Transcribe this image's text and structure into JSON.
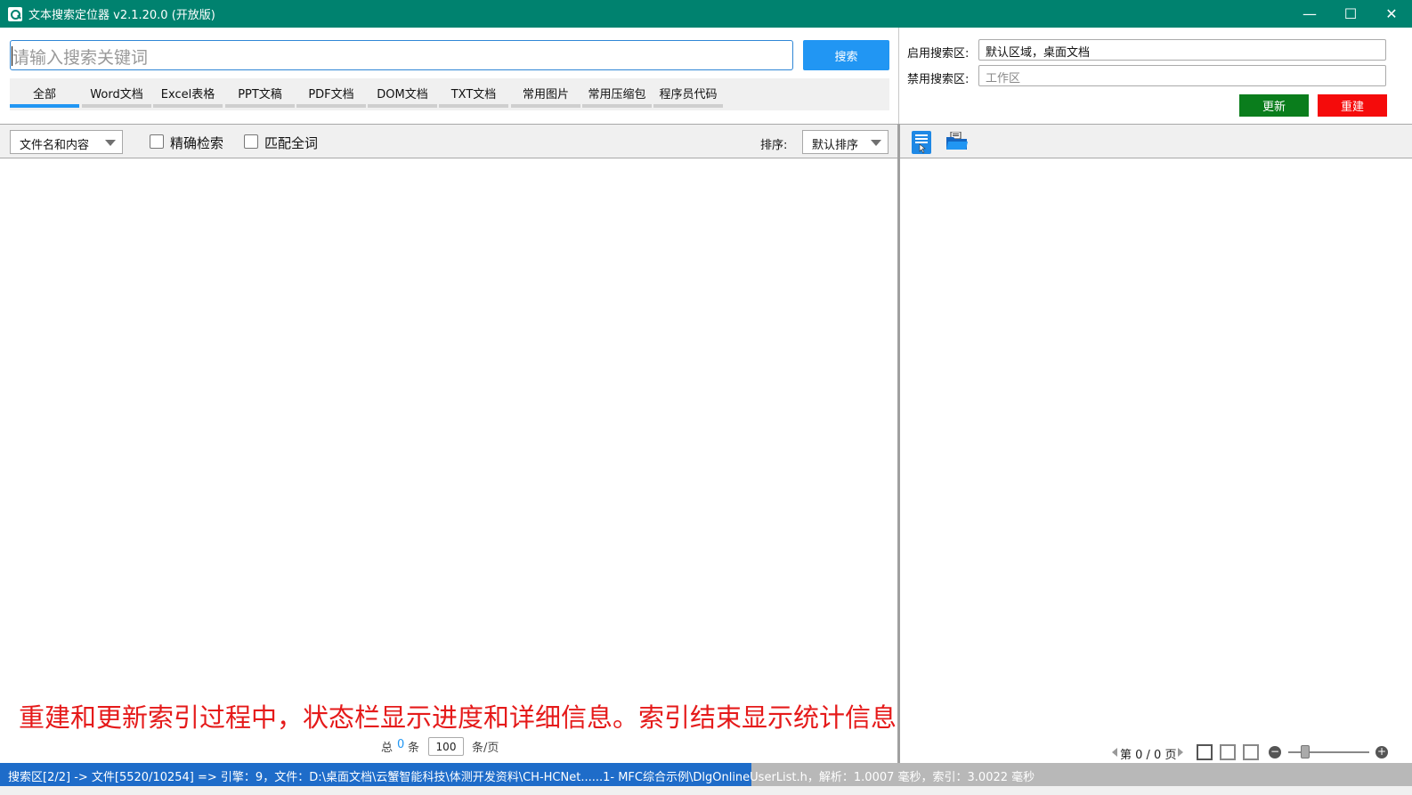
{
  "window": {
    "title": "文本搜索定位器 v2.1.20.0 (开放版)",
    "minimize": "—",
    "maximize": "☐",
    "close": "✕"
  },
  "search": {
    "placeholder": "请输入搜索关键词",
    "button": "搜索"
  },
  "tabs": [
    {
      "label": "全部",
      "active": true
    },
    {
      "label": "Word文档"
    },
    {
      "label": "Excel表格"
    },
    {
      "label": "PPT文稿"
    },
    {
      "label": "PDF文档"
    },
    {
      "label": "DOM文档"
    },
    {
      "label": "TXT文档"
    },
    {
      "label": "常用图片"
    },
    {
      "label": "常用压缩包"
    },
    {
      "label": "程序员代码"
    }
  ],
  "areas": {
    "enabled_label": "启用搜索区:",
    "enabled_value": "默认区域，桌面文档",
    "disabled_label": "禁用搜索区:",
    "disabled_placeholder": "工作区",
    "update_button": "更新",
    "rebuild_button": "重建"
  },
  "filter": {
    "scope_value": "文件名和内容",
    "exact_label": "精确检索",
    "whole_word_label": "匹配全词",
    "sort_label": "排序:",
    "sort_value": "默认排序"
  },
  "overlay_caption": "重建和更新索引过程中，状态栏显示进度和详细信息。索引结束显示统计信息",
  "pager": {
    "total_prefix": "总",
    "total_count": "0",
    "total_suffix": "条",
    "per_page": "100",
    "per_page_suffix": "条/页"
  },
  "preview": {
    "page_text": "第 0 / 0 页"
  },
  "status": {
    "text": "搜索区[2/2] -> 文件[5520/10254] => 引擎：9，文件：D:\\桌面文档\\云蟹智能科技\\体测开发资料\\CH-HCNet......1- MFC综合示例\\DlgOnlineUserList.h，解析：1.0007 毫秒，索引：3.0022 毫秒",
    "progress": 0.532
  },
  "colors": {
    "titlebar": "#00826f",
    "accent": "#2196f3",
    "update": "#0a7d1c",
    "rebuild": "#f50b0b",
    "status_progress": "#1e6cc9"
  }
}
